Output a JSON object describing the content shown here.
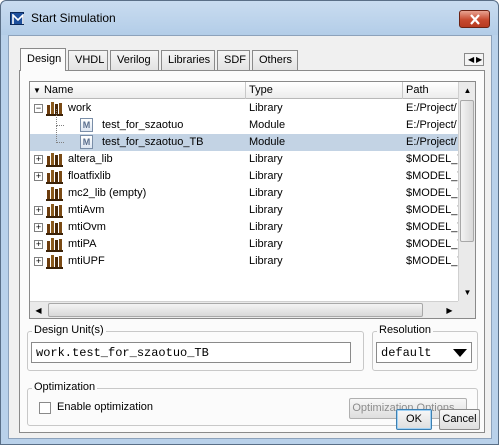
{
  "window": {
    "title": "Start Simulation"
  },
  "tabs": [
    {
      "label": "Design"
    },
    {
      "label": "VHDL"
    },
    {
      "label": "Verilog"
    },
    {
      "label": "Libraries"
    },
    {
      "label": "SDF"
    },
    {
      "label": "Others"
    }
  ],
  "table": {
    "headers": [
      "Name",
      "Type",
      "Path"
    ],
    "rows": [
      {
        "name": "work",
        "type": "Library",
        "path": "E:/Project/",
        "kind": "library",
        "expander": "−",
        "level": 0
      },
      {
        "name": "test_for_szaotuo",
        "type": "Module",
        "path": "E:/Project/",
        "kind": "module",
        "level": 1
      },
      {
        "name": "test_for_szaotuo_TB",
        "type": "Module",
        "path": "E:/Project/",
        "kind": "module",
        "level": 1,
        "selected": true
      },
      {
        "name": "altera_lib",
        "type": "Library",
        "path": "$MODEL_T",
        "kind": "library",
        "expander": "+",
        "level": 0
      },
      {
        "name": "floatfixlib",
        "type": "Library",
        "path": "$MODEL_T",
        "kind": "library",
        "expander": "+",
        "level": 0
      },
      {
        "name": "mc2_lib  (empty)",
        "type": "Library",
        "path": "$MODEL_T",
        "kind": "library",
        "level": 0
      },
      {
        "name": "mtiAvm",
        "type": "Library",
        "path": "$MODEL_T",
        "kind": "library",
        "expander": "+",
        "level": 0
      },
      {
        "name": "mtiOvm",
        "type": "Library",
        "path": "$MODEL_T",
        "kind": "library",
        "expander": "+",
        "level": 0
      },
      {
        "name": "mtiPA",
        "type": "Library",
        "path": "$MODEL_T",
        "kind": "library",
        "expander": "+",
        "level": 0
      },
      {
        "name": "mtiUPF",
        "type": "Library",
        "path": "$MODEL_T",
        "kind": "library",
        "expander": "+",
        "level": 0
      }
    ]
  },
  "design_unit": {
    "label": "Design Unit(s)",
    "value": "work.test_for_szaotuo_TB"
  },
  "resolution": {
    "label": "Resolution",
    "value": "default"
  },
  "optimization": {
    "label": "Optimization",
    "enable_label": "Enable optimization",
    "enabled": false,
    "options_button": "Optimization Options..."
  },
  "buttons": {
    "ok": "OK",
    "cancel": "Cancel"
  },
  "colors": {
    "selection": "#c3d3e4",
    "titlebar": "#b9d1ea",
    "close": "#c74a2f"
  }
}
